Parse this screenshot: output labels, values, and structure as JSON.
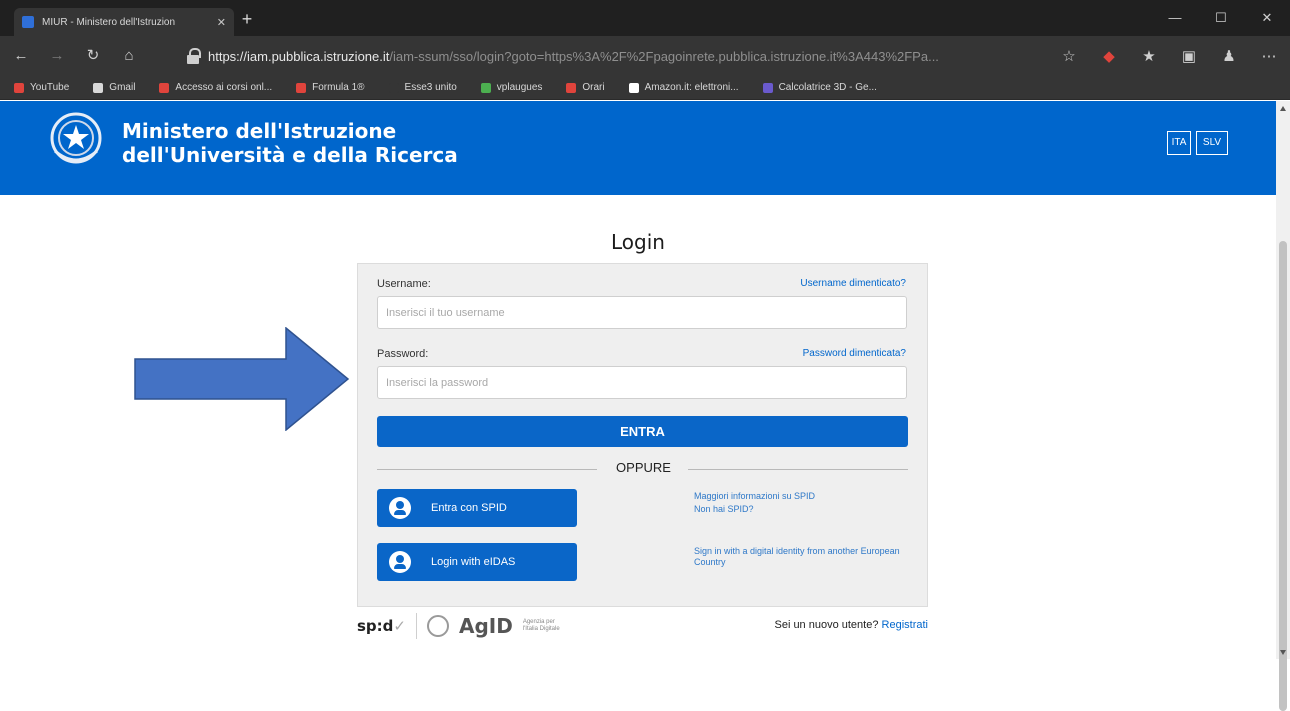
{
  "browser": {
    "tab_title": "MIUR - Ministero dell'Istruzion",
    "tab_close": "✕",
    "new_tab": "+",
    "url_main": "https://iam.pubblica.istruzione.it",
    "url_rest": "/iam-ssum/sso/login?goto=https%3A%2F%2Fpagoinrete.pubblica.istruzione.it%3A443%2FPa...",
    "window_controls": [
      "—",
      "☐",
      "✕"
    ],
    "bookmarks": [
      {
        "label": "YouTube",
        "color": "#e0443c"
      },
      {
        "label": "Gmail",
        "color": "#d8d8d8"
      },
      {
        "label": "Accesso ai corsi onl...",
        "color": "#e0443c"
      },
      {
        "label": "Formula 1®",
        "color": "#e0443c"
      },
      {
        "label": "Esse3 unito",
        "color": "#353535"
      },
      {
        "label": "vplaugues",
        "color": "#4caf50"
      },
      {
        "label": "Orari",
        "color": "#e0443c"
      },
      {
        "label": "Amazon.it: elettroni...",
        "color": "#ffffff"
      },
      {
        "label": "Calcolatrice 3D - Ge...",
        "color": "#6a5acd"
      }
    ]
  },
  "header": {
    "ministry_line1": "Ministero dell'Istruzione",
    "ministry_line2": "dell'Università e della Ricerca",
    "lang_ita": "ITA",
    "lang_slv": "SLV",
    "brand_color": "#0066cc"
  },
  "login": {
    "title": "Login",
    "username_label": "Username:",
    "username_forgot": "Username dimenticato?",
    "username_placeholder": "Inserisci il tuo username",
    "password_label": "Password:",
    "password_forgot": "Password dimenticata?",
    "password_placeholder": "Inserisci la password",
    "submit_label": "ENTRA",
    "separator": "OPPURE",
    "spid_button": "Entra con SPID",
    "spid_info_line1": "Maggiori informazioni su SPID",
    "spid_info_line2": "Non hai SPID?",
    "eidas_button": "Login with eIDAS",
    "eidas_info": "Sign in with a digital identity from another European Country"
  },
  "footer": {
    "spid_logo": "sp:d",
    "spid_check": "✓",
    "agid_logo": "AgID",
    "agid_sub": "Agenzia per l'Italia Digitale",
    "new_user_text": "Sei un nuovo utente?",
    "register_link": "Registrati"
  },
  "annotation": {
    "arrow_color": "#4472c4"
  }
}
